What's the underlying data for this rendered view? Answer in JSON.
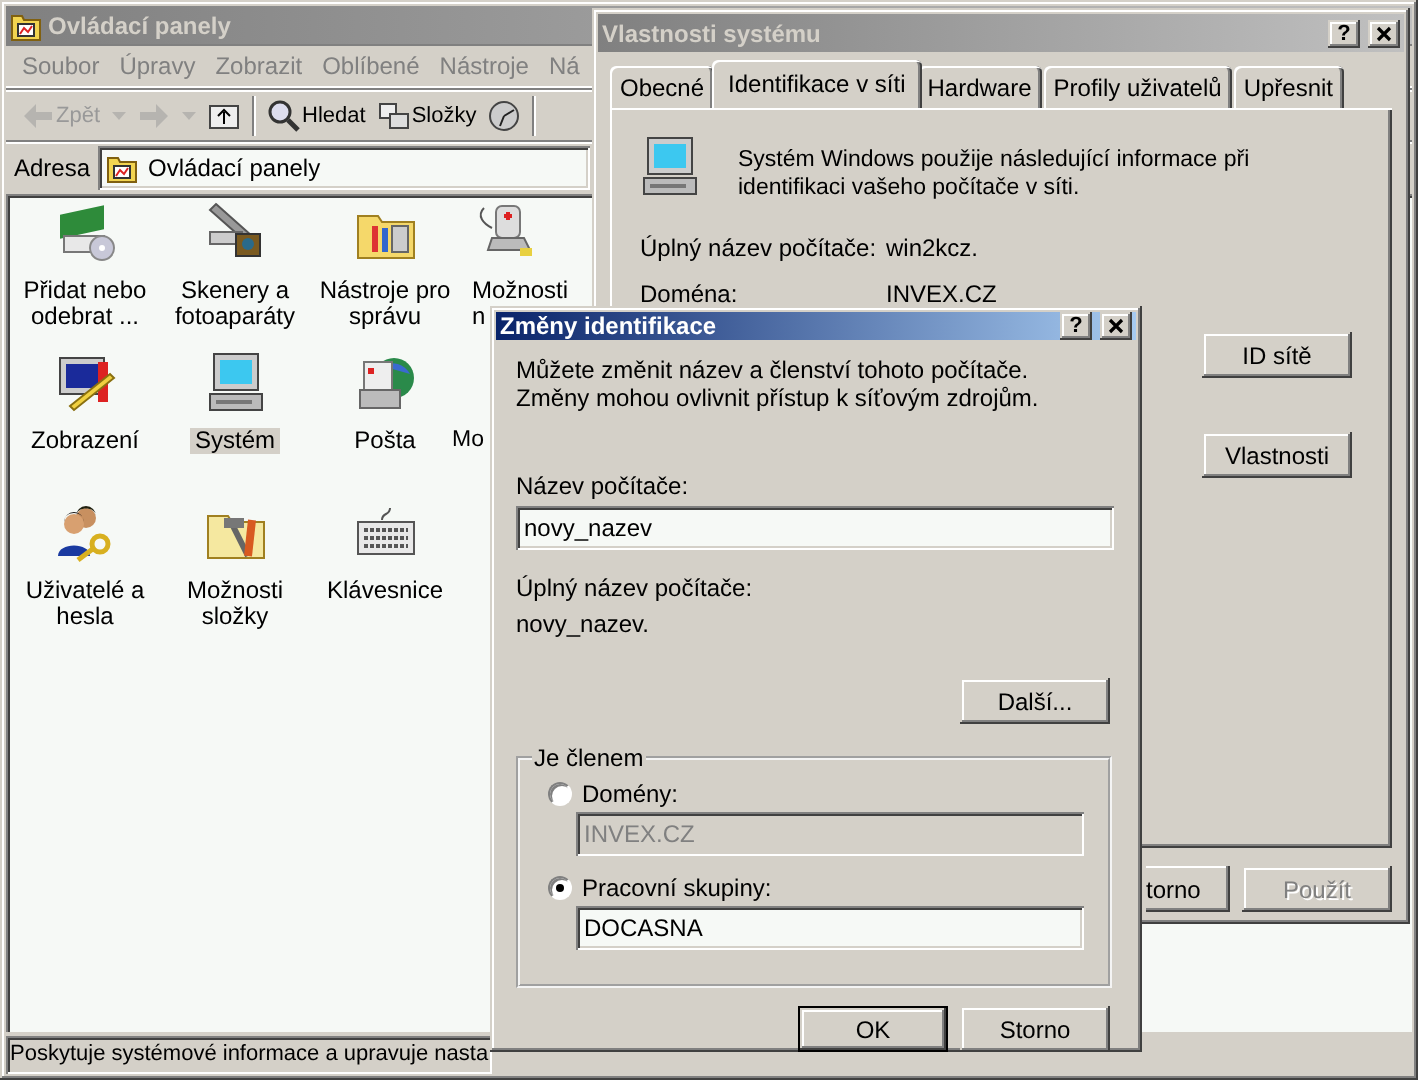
{
  "explorer": {
    "title": "Ovládací panely",
    "menu": [
      "Soubor",
      "Úpravy",
      "Zobrazit",
      "Oblíbené",
      "Nástroje",
      "Ná"
    ],
    "toolbar": [
      {
        "kind": "back",
        "label": "Zpět",
        "disabled": true
      },
      {
        "kind": "forward",
        "disabled": true
      },
      {
        "kind": "up",
        "disabled": false
      },
      {
        "kind": "search",
        "label": "Hledat",
        "disabled": false
      },
      {
        "kind": "folders",
        "label": "Složky",
        "disabled": false
      },
      {
        "kind": "history",
        "disabled": false
      }
    ],
    "address": {
      "label": "Adresa",
      "value": "Ovládací panely"
    },
    "items": [
      {
        "kind": "software",
        "label": "Přidat nebo odebrat ...",
        "selected": false
      },
      {
        "kind": "scanner",
        "label": "Skenery a fotoaparáty",
        "selected": false
      },
      {
        "kind": "tools",
        "label": "Nástroje pro správu",
        "selected": false
      },
      {
        "kind": "power",
        "label": "Možnosti\nn",
        "selected": false
      },
      {
        "kind": "display",
        "label": "Zobrazení",
        "selected": false
      },
      {
        "kind": "computer",
        "label": "Systém",
        "selected": true
      },
      {
        "kind": "mail",
        "label": "Pošta",
        "selected": false
      },
      {
        "label": "Mo",
        "selected": false
      },
      {
        "kind": "users",
        "label": "Uživatelé a hesla",
        "selected": false
      },
      {
        "kind": "folder_options",
        "label": "Možnosti složky",
        "selected": false
      },
      {
        "kind": "keyboard",
        "label": "Klávesnice",
        "selected": false
      }
    ],
    "status_bar": "Poskytuje systémové informace a upravuje nasta"
  },
  "system_properties": {
    "title": "Vlastnosti systému",
    "help": "?",
    "tabs": [
      {
        "label": "Obecné",
        "selected": false
      },
      {
        "label": "Identifikace v síti",
        "selected": true
      },
      {
        "label": "Hardware",
        "selected": false
      },
      {
        "label": "Profily uživatelů",
        "selected": false
      },
      {
        "label": "Upřesnit",
        "selected": false
      }
    ],
    "description": "Systém Windows použije následující informace při identifikaci vašeho počítače v síti.",
    "fields": [
      {
        "label": "Úplný název počítače:",
        "value": "win2kcz."
      },
      {
        "label": "Doména:",
        "value": "INVEX.CZ"
      }
    ],
    "side_buttons": [
      "ID sítě",
      "Vlastnosti"
    ],
    "footer_buttons": [
      {
        "label": "torno",
        "disabled": false
      },
      {
        "label": "Použít",
        "disabled": true
      }
    ]
  },
  "dialog": {
    "title": "Změny identifikace",
    "help": "?",
    "intro": "Můžete změnit název a členství tohoto počítače. Změny mohou ovlivnit přístup k síťovým zdrojům.",
    "name_label": "Název počítače:",
    "name_value": "novy_nazev",
    "full_name_label": "Úplný název počítače:",
    "full_name_value": "novy_nazev.",
    "more_button": "Další...",
    "member_group": {
      "legend": "Je členem",
      "options": [
        {
          "label": "Domény:",
          "selected": false,
          "value": "INVEX.CZ",
          "disabled": true
        },
        {
          "label": "Pracovní skupiny:",
          "selected": true,
          "value": "DOCASNA",
          "disabled": false
        }
      ]
    },
    "buttons": [
      {
        "label": "OK",
        "default": true
      },
      {
        "label": "Storno",
        "default": false
      }
    ]
  }
}
